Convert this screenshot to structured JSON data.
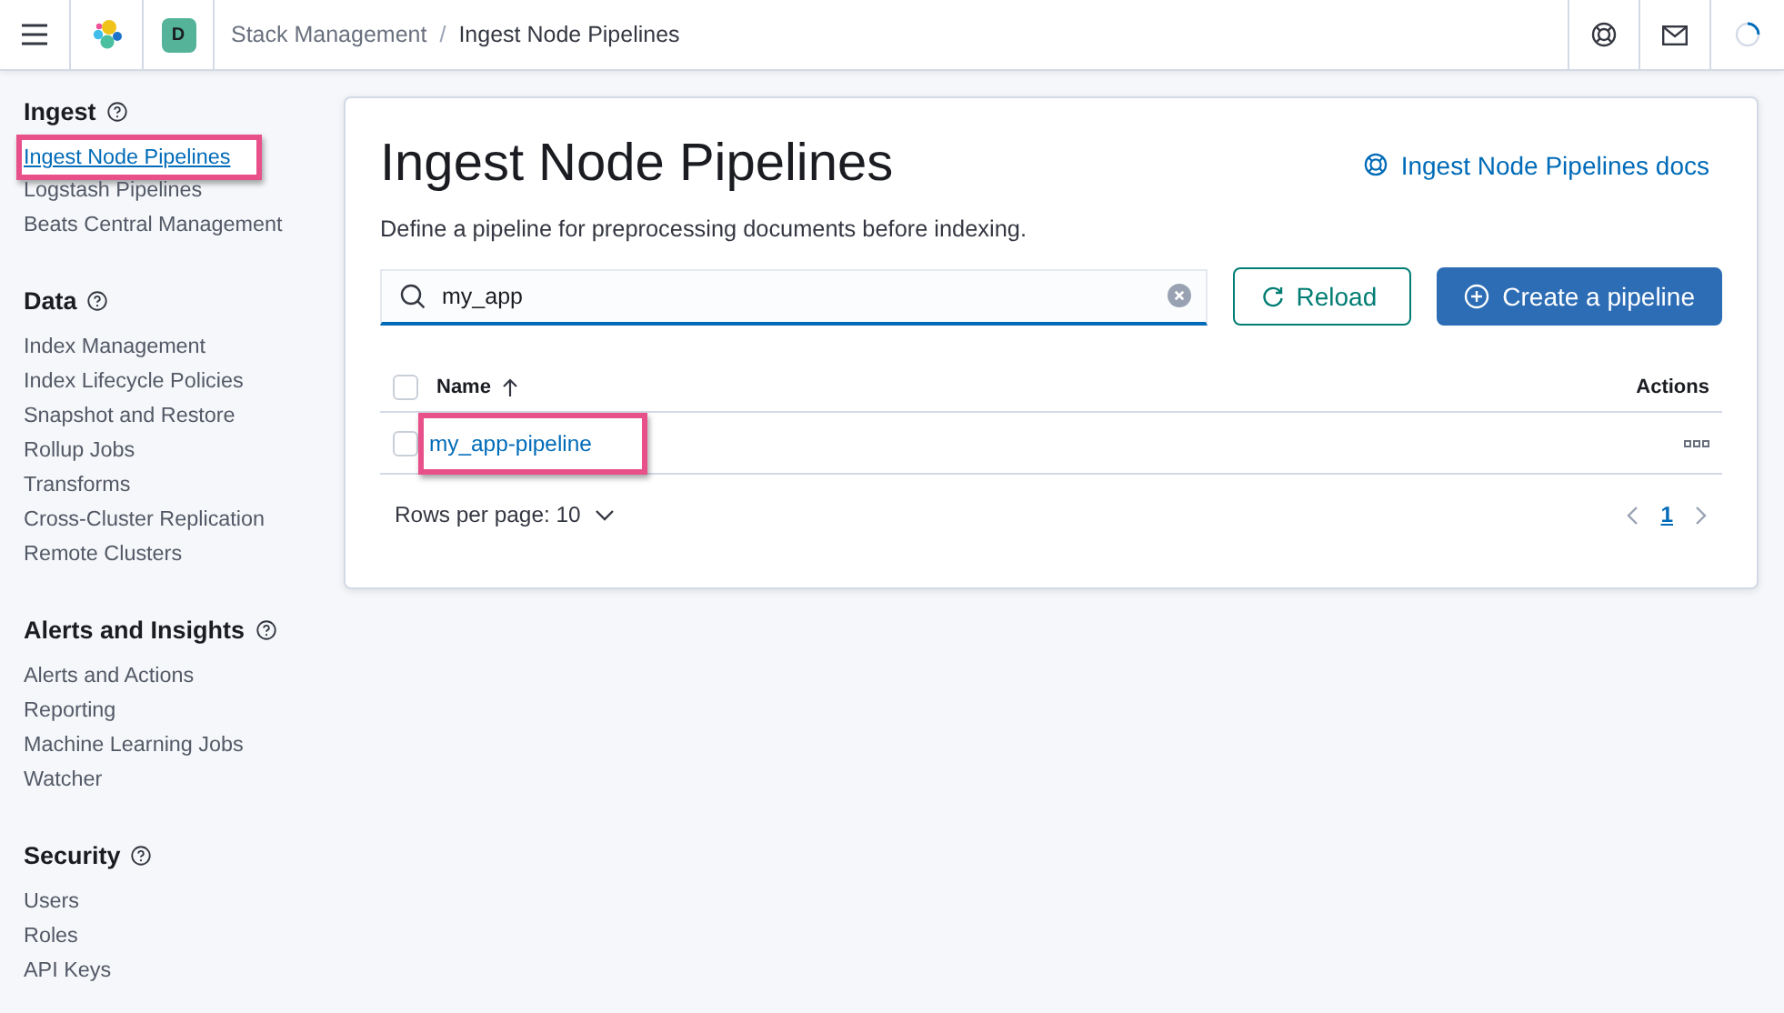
{
  "header": {
    "avatar": "D",
    "separator": "/",
    "breadcrumbs": [
      {
        "label": "Stack Management",
        "current": false
      },
      {
        "label": "Ingest Node Pipelines",
        "current": true
      }
    ]
  },
  "sidebar": {
    "sections": [
      {
        "title": "Ingest",
        "items": [
          {
            "label": "Ingest Node Pipelines",
            "selected": true,
            "highlighted": true
          },
          {
            "label": "Logstash Pipelines",
            "selected": false,
            "highlighted": false
          },
          {
            "label": "Beats Central Management",
            "selected": false,
            "highlighted": false
          }
        ]
      },
      {
        "title": "Data",
        "items": [
          {
            "label": "Index Management",
            "selected": false,
            "highlighted": false
          },
          {
            "label": "Index Lifecycle Policies",
            "selected": false,
            "highlighted": false
          },
          {
            "label": "Snapshot and Restore",
            "selected": false,
            "highlighted": false
          },
          {
            "label": "Rollup Jobs",
            "selected": false,
            "highlighted": false
          },
          {
            "label": "Transforms",
            "selected": false,
            "highlighted": false
          },
          {
            "label": "Cross-Cluster Replication",
            "selected": false,
            "highlighted": false
          },
          {
            "label": "Remote Clusters",
            "selected": false,
            "highlighted": false
          }
        ]
      },
      {
        "title": "Alerts and Insights",
        "items": [
          {
            "label": "Alerts and Actions",
            "selected": false,
            "highlighted": false
          },
          {
            "label": "Reporting",
            "selected": false,
            "highlighted": false
          },
          {
            "label": "Machine Learning Jobs",
            "selected": false,
            "highlighted": false
          },
          {
            "label": "Watcher",
            "selected": false,
            "highlighted": false
          }
        ]
      },
      {
        "title": "Security",
        "items": [
          {
            "label": "Users",
            "selected": false,
            "highlighted": false
          },
          {
            "label": "Roles",
            "selected": false,
            "highlighted": false
          },
          {
            "label": "API Keys",
            "selected": false,
            "highlighted": false
          }
        ]
      }
    ]
  },
  "panel": {
    "title": "Ingest Node Pipelines",
    "docs_link": "Ingest Node Pipelines docs",
    "description": "Define a pipeline for preprocessing documents before indexing.",
    "search": {
      "value": "my_app"
    },
    "buttons": [
      {
        "label": "Reload",
        "kind": "secondary"
      },
      {
        "label": "Create a pipeline",
        "kind": "primary"
      }
    ],
    "table": {
      "select_all_checked": false,
      "columns": [
        {
          "label": "Name",
          "sorted": true
        },
        {
          "label": "Actions",
          "sorted": false
        }
      ],
      "rows": [
        {
          "name": "my_app-pipeline",
          "checked": false,
          "highlighted": true
        }
      ]
    },
    "rows_per_page": "Rows per page: 10",
    "pages": [
      {
        "label": "1",
        "selected": true
      }
    ]
  }
}
